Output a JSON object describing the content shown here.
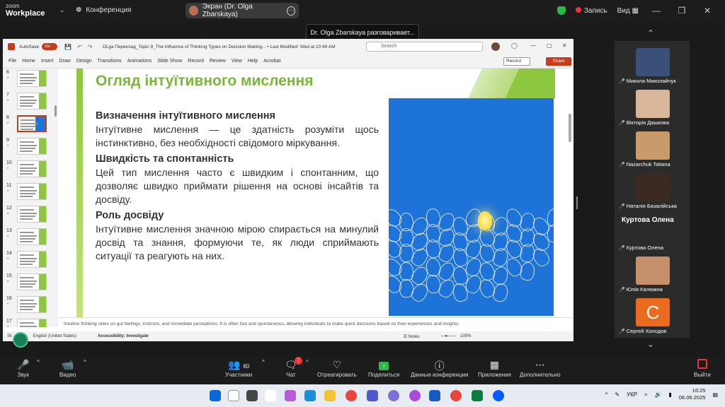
{
  "zoom": {
    "logo_top": "zoom",
    "logo_bottom": "Workplace",
    "meeting_label": "Конференция",
    "screen_share_label": "Экран (Dr. Olga Zbarskaya)",
    "record_label": "Запись",
    "view_label": "Вид",
    "speaking_tooltip": "Dr. Olga Zbarskaya разговаривает...",
    "colors": {
      "record": "#e33333",
      "shield": "#2eb84c"
    }
  },
  "ppt": {
    "autosave_label": "AutoSave",
    "autosave_state": "On",
    "file_title": "OLga Переклад_Topic 9_The Influence of Thinking Types on Decision Making...  •  Last Modified: Wed at 10:49 AM",
    "search_placeholder": "Search",
    "tabs": [
      "File",
      "Home",
      "Insert",
      "Draw",
      "Design",
      "Transitions",
      "Animations",
      "Slide Show",
      "Record",
      "Review",
      "View",
      "Help",
      "Acrobat"
    ],
    "record_button": "Record",
    "share_button": "Share",
    "thumbnails": [
      {
        "num": "6",
        "star": "*"
      },
      {
        "num": "7",
        "star": "*"
      },
      {
        "num": "8",
        "star": "*"
      },
      {
        "num": "9",
        "star": "*"
      },
      {
        "num": "10",
        "star": "*"
      },
      {
        "num": "11",
        "star": "*"
      },
      {
        "num": "12",
        "star": "*"
      },
      {
        "num": "13",
        "star": "*"
      },
      {
        "num": "14",
        "star": "*"
      },
      {
        "num": "15",
        "star": "*"
      },
      {
        "num": "16",
        "star": "*"
      },
      {
        "num": "17",
        "star": "*"
      }
    ],
    "selected_slide": "8",
    "slide": {
      "title": "Огляд інтуїтивного мислення",
      "sections": [
        {
          "heading": "Визначення інтуїтивного мислення",
          "text": "Інтуїтивне мислення — це здатність розуміти щось інстинктивно, без необхідності свідомого міркування."
        },
        {
          "heading": "Швидкість та спонтанність",
          "text": "Цей тип мислення часто є швидким і спонтанним, що дозволяє швидко приймати рішення на основі інсайтів та досвіду."
        },
        {
          "heading": "Роль досвіду",
          "text": "Інтуїтивне мислення значною мірою спирається на минулий досвід та знання, формуючи те, як люди сприймають ситуації та реагують на них."
        }
      ],
      "colors": {
        "title": "#7ab63a",
        "image_bg": "#1e73d8"
      }
    },
    "notes": "Intuitive thinking relies on gut feelings, instincts, and immediate perceptions. It is often fast and spontaneous, allowing individuals to make quick decisions based on their experiences and insights.",
    "status": {
      "slide_info": "Sli",
      "language": "English (United States)",
      "accessibility": "Accessibility: Investigate",
      "notes_label": "Notes",
      "zoom": "100%"
    }
  },
  "participants": [
    {
      "name": "Микола Миколайчук",
      "type": "photo",
      "color": "#3a4f7a"
    },
    {
      "name": "Вікторія  Дашкова",
      "type": "photo",
      "color": "#d9b59a"
    },
    {
      "name": "Nazarchuk Tatiana",
      "type": "photo",
      "color": "#c99a6a"
    },
    {
      "name": "Наталія Базалійська",
      "type": "photo",
      "color": "#3a2a22"
    },
    {
      "name": "Куртова Олена",
      "type": "name",
      "big": "Куртова Олена"
    },
    {
      "name": "Юлія Калюжна",
      "type": "photo",
      "color": "#c7906c"
    },
    {
      "name": "Сергей Холодов",
      "type": "letter",
      "letter": "С"
    }
  ],
  "controls": {
    "audio": "Звук",
    "video": "Видео",
    "participants": "Участники",
    "participants_count": "60",
    "chat": "Чат",
    "chat_badge": "1",
    "react": "Отреагировать",
    "share": "Поделиться",
    "meeting_data": "Данные конференции",
    "apps": "Приложения",
    "more": "Дополнительно",
    "leave": "Выйти"
  },
  "taskbar": {
    "language": "УКР",
    "time": "16:25",
    "date": "06.06.2025",
    "badges": [
      "6",
      "6"
    ]
  }
}
